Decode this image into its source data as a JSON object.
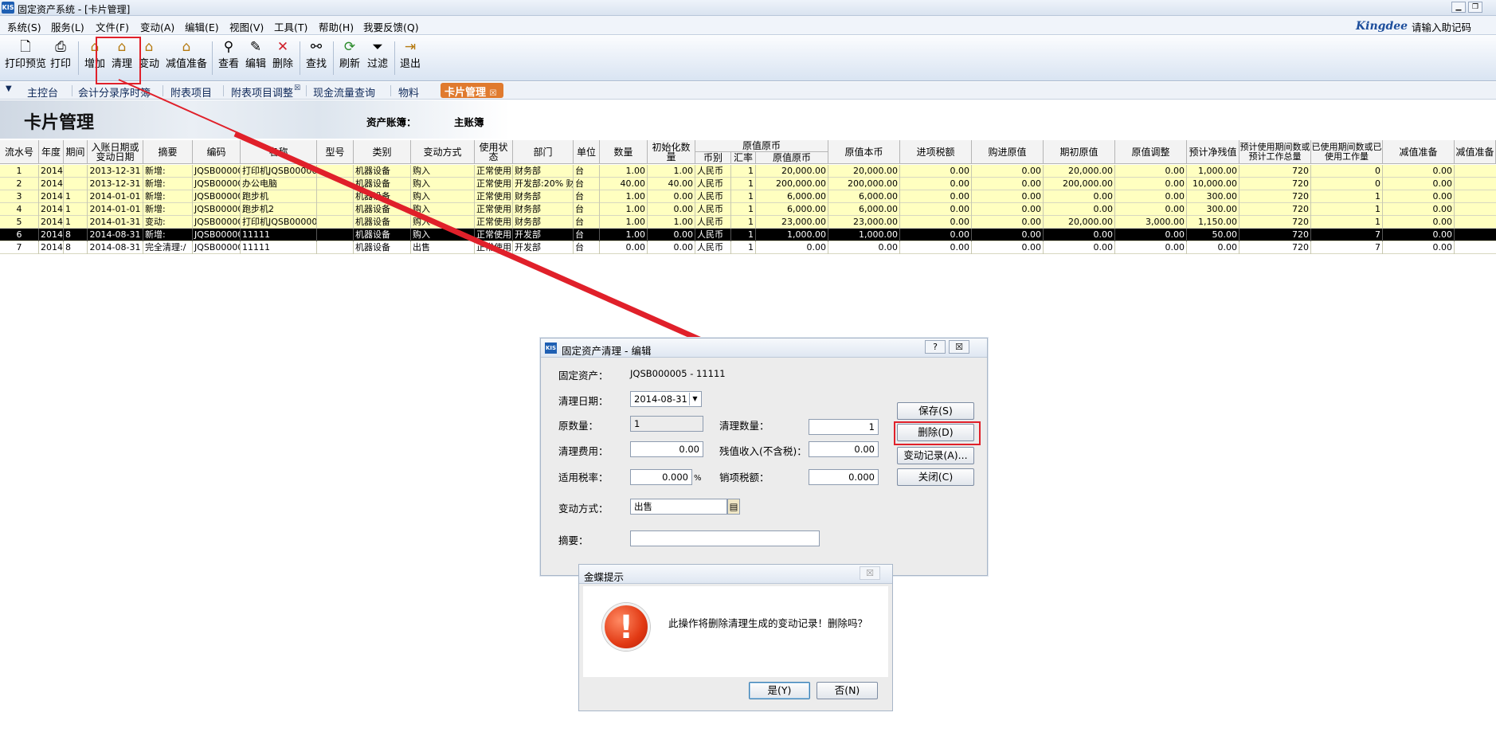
{
  "window": {
    "title": "固定资产系统 - [卡片管理]",
    "logo": "KIS"
  },
  "menu": [
    "系统(S)",
    "服务(L)",
    "文件(F)",
    "变动(A)",
    "编辑(E)",
    "视图(V)",
    "工具(T)",
    "帮助(H)",
    "我要反馈(Q)"
  ],
  "brand": {
    "name": "Kingdee",
    "hint": "请输入助记码"
  },
  "toolbar": [
    {
      "label": "打印预览",
      "icon": "print-preview-icon"
    },
    {
      "label": "打印",
      "icon": "print-icon"
    },
    {
      "label": "增加",
      "icon": "house-add-icon"
    },
    {
      "label": "清理",
      "icon": "house-clear-icon"
    },
    {
      "label": "变动",
      "icon": "house-change-icon"
    },
    {
      "label": "减值准备",
      "icon": "house-impairment-icon"
    },
    {
      "label": "查看",
      "icon": "magnifier-icon"
    },
    {
      "label": "编辑",
      "icon": "edit-pen-icon"
    },
    {
      "label": "删除",
      "icon": "delete-x-icon"
    },
    {
      "label": "查找",
      "icon": "binoculars-icon"
    },
    {
      "label": "刷新",
      "icon": "refresh-icon"
    },
    {
      "label": "过滤",
      "icon": "filter-icon"
    },
    {
      "label": "退出",
      "icon": "exit-icon"
    }
  ],
  "tabs": [
    "主控台",
    "会计分录序时簿",
    "附表项目",
    "附表项目调整",
    "现金流量查询",
    "物料",
    "卡片管理"
  ],
  "banner": {
    "title": "卡片管理",
    "ledger_label": "资产账簿：",
    "ledger_value": "主账簿"
  },
  "grid": {
    "headers": [
      "流水号",
      "年度",
      "期间",
      "入账日期或变动日期",
      "摘要",
      "编码",
      "名称",
      "型号",
      "类别",
      "变动方式",
      "使用状态",
      "部门",
      "单位",
      "数量",
      "初始化数量",
      "原值原币",
      "币别",
      "汇率",
      "原值原币",
      "原值本币",
      "进项税额",
      "购进原值",
      "期初原值",
      "原值调整",
      "预计净残值",
      "预计使用期间数或预计工作总量",
      "已使用期间数或已使用工作量",
      "减值准备",
      "减值准备"
    ],
    "rows": [
      [
        "1",
        "2014",
        "",
        "2013-12-31",
        "新增:",
        "JQSB000001",
        "打印机JQSB000001",
        "",
        "机器设备",
        "购入",
        "正常使用",
        "财务部",
        "台",
        "1.00",
        "1.00",
        "人民币",
        "1",
        "20,000.00",
        "20,000.00",
        "0.00",
        "0.00",
        "20,000.00",
        "0.00",
        "1,000.00",
        "720",
        "0",
        "0.00"
      ],
      [
        "2",
        "2014",
        "",
        "2013-12-31",
        "新增:",
        "JQSB000002",
        "办公电脑",
        "",
        "机器设备",
        "购入",
        "正常使用",
        "开发部:20% 财务",
        "台",
        "40.00",
        "40.00",
        "人民币",
        "1",
        "200,000.00",
        "200,000.00",
        "0.00",
        "0.00",
        "200,000.00",
        "0.00",
        "10,000.00",
        "720",
        "0",
        "0.00"
      ],
      [
        "3",
        "2014",
        "1",
        "2014-01-01",
        "新增:",
        "JQSB000003",
        "跑步机",
        "",
        "机器设备",
        "购入",
        "正常使用",
        "财务部",
        "台",
        "1.00",
        "0.00",
        "人民币",
        "1",
        "6,000.00",
        "6,000.00",
        "0.00",
        "0.00",
        "0.00",
        "0.00",
        "300.00",
        "720",
        "1",
        "0.00"
      ],
      [
        "4",
        "2014",
        "1",
        "2014-01-01",
        "新增:",
        "JQSB000004",
        "跑步机2",
        "",
        "机器设备",
        "购入",
        "正常使用",
        "财务部",
        "台",
        "1.00",
        "0.00",
        "人民币",
        "1",
        "6,000.00",
        "6,000.00",
        "0.00",
        "0.00",
        "0.00",
        "0.00",
        "300.00",
        "720",
        "1",
        "0.00"
      ],
      [
        "5",
        "2014",
        "1",
        "2014-01-31",
        "变动:",
        "JQSB000001",
        "打印机JQSB000001",
        "",
        "机器设备",
        "购入",
        "正常使用",
        "财务部",
        "台",
        "1.00",
        "1.00",
        "人民币",
        "1",
        "23,000.00",
        "23,000.00",
        "0.00",
        "0.00",
        "20,000.00",
        "3,000.00",
        "1,150.00",
        "720",
        "1",
        "0.00"
      ],
      [
        "6",
        "2014",
        "8",
        "2014-08-31",
        "新增:",
        "JQSB000005",
        "11111",
        "",
        "机器设备",
        "购入",
        "正常使用",
        "开发部",
        "台",
        "1.00",
        "0.00",
        "人民币",
        "1",
        "1,000.00",
        "1,000.00",
        "0.00",
        "0.00",
        "0.00",
        "0.00",
        "50.00",
        "720",
        "7",
        "0.00"
      ],
      [
        "7",
        "2014",
        "8",
        "2014-08-31",
        "完全清理:/",
        "JQSB000005",
        "11111",
        "",
        "机器设备",
        "出售",
        "正常使用",
        "开发部",
        "台",
        "0.00",
        "0.00",
        "人民币",
        "1",
        "0.00",
        "0.00",
        "0.00",
        "0.00",
        "0.00",
        "0.00",
        "0.00",
        "720",
        "7",
        "0.00"
      ]
    ]
  },
  "dialog": {
    "title": "固定资产清理 - 编辑",
    "help": "?",
    "close": "☒",
    "asset_label": "固定资产：",
    "asset_value": "JQSB000005 - 11111",
    "date_label": "清理日期：",
    "date_value": "2014-08-31",
    "orig_qty_label": "原数量：",
    "orig_qty_value": "1",
    "clear_qty_label": "清理数量：",
    "clear_qty_value": "1",
    "fee_label": "清理费用：",
    "fee_value": "0.00",
    "residual_label": "残值收入(不含税)：",
    "residual_value": "0.00",
    "tax_label": "适用税率：",
    "tax_value": "0.000",
    "tax_unit": "%",
    "output_tax_label": "销项税额：",
    "output_tax_value": "0.000",
    "method_label": "变动方式：",
    "method_value": "出售",
    "summary_label": "摘要：",
    "summary_value": "",
    "buttons": {
      "save": "保存(S)",
      "delete": "删除(D)",
      "history": "变动记录(A)...",
      "close": "关闭(C)"
    }
  },
  "message": {
    "title": "金蝶提示",
    "close": "☒",
    "text": "此操作将删除清理生成的变动记录！删除吗？",
    "yes": "是(Y)",
    "no": "否(N)"
  },
  "colors": {
    "highlight_row": "#ffffc0",
    "selected_row": "#000000",
    "annotation": "#e0202a",
    "active_tab": "#e07a2e"
  }
}
